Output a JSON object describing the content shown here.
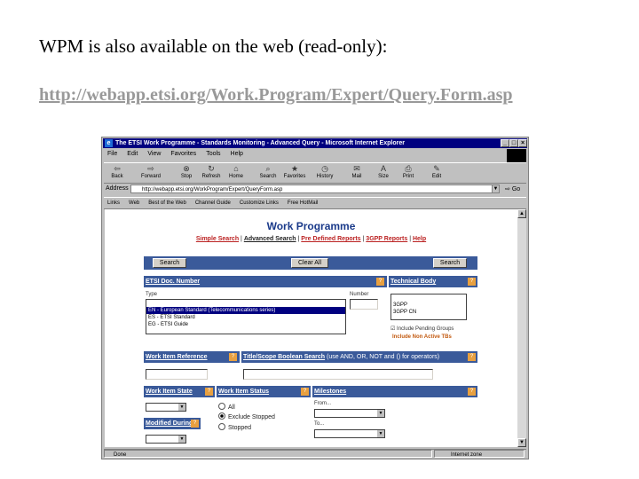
{
  "slide": {
    "title": "WPM is also available on the web (read-only):",
    "link": "http://webapp.etsi.org/Work.Program/Expert/Query.Form.asp"
  },
  "browser": {
    "title": "The ETSI Work Programme - Standards Monitoring - Advanced Query - Microsoft Internet Explorer",
    "menu": [
      "File",
      "Edit",
      "View",
      "Favorites",
      "Tools",
      "Help"
    ],
    "toolbar": [
      "Back",
      "Forward",
      "Stop",
      "Refresh",
      "Home",
      "Search",
      "Favorites",
      "History",
      "Mail",
      "Size",
      "Print",
      "Edit"
    ],
    "address_label": "Address",
    "address_value": "http://webapp.etsi.org/WorkProgram/Expert/QueryForm.asp",
    "go_label": "Go",
    "links": [
      "Links",
      "Web",
      "Best of the Web",
      "Channel Guide",
      "Customize Links",
      "Free HotMail"
    ],
    "status_left": "Done",
    "status_right": "Internet zone"
  },
  "page": {
    "heading": "Work Programme",
    "nav": [
      "Simple Search",
      "Advanced Search",
      "Pre Defined Reports",
      "3GPP Reports",
      "Help"
    ],
    "buttons": {
      "search": "Search",
      "clear": "Clear All"
    },
    "etsi_doc_number": "ETSI Doc. Number",
    "technical_body": "Technical Body",
    "type_label": "Type",
    "number_label": "Number",
    "type_options": [
      "EN - European Standard (Telecommunications series)",
      "ES - ETSI Standard",
      "EG - ETSI Guide"
    ],
    "tb_options": [
      "3GPP",
      "3GPP CN"
    ],
    "include_pending": "Include Pending Groups",
    "include_non_active": "Include Non Active TBs",
    "work_item_reference": "Work Item Reference",
    "title_scope_search": "Title/Scope Boolean Search",
    "title_scope_hint": "(use AND, OR, NOT and () for operators)",
    "work_item_state": "Work Item State",
    "work_item_status": "Work Item Status",
    "milestones": "Milestones",
    "status_options": [
      "All",
      "Exclude Stopped",
      "Stopped"
    ],
    "from_label": "From...",
    "to_label": "To...",
    "modified_during": "Modified During",
    "help_mark": "?"
  }
}
